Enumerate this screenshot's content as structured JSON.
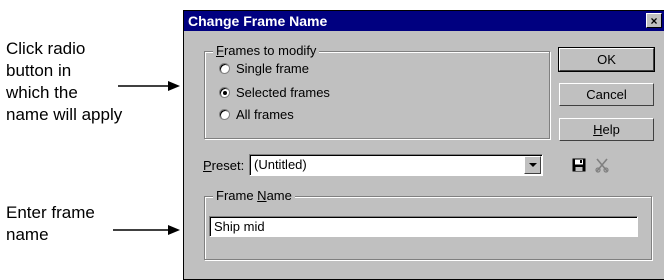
{
  "callouts": {
    "radio_hint": [
      "Click radio",
      "button in",
      "which the",
      "name will apply"
    ],
    "name_hint": [
      "Enter frame",
      "name"
    ]
  },
  "dialog": {
    "title": "Change Frame Name",
    "close_glyph": "×",
    "frames_group": {
      "legend_prefix": "",
      "legend_underlined": "F",
      "legend_rest": "rames to modify",
      "options": [
        {
          "label": "Single frame",
          "checked": false
        },
        {
          "label": "Selected frames",
          "checked": true
        },
        {
          "label": "All frames",
          "checked": false
        }
      ]
    },
    "buttons": {
      "ok": "OK",
      "cancel": "Cancel",
      "help_underlined": "H",
      "help_rest": "elp"
    },
    "preset": {
      "label_underlined": "P",
      "label_rest": "reset:",
      "value": "(Untitled)"
    },
    "name_group": {
      "legend_prefix": "Frame ",
      "legend_underlined": "N",
      "legend_rest": "ame",
      "value": "Ship mid"
    },
    "icons": {
      "save": "save-icon",
      "delete": "delete-icon",
      "dropdown": "chevron-down-icon"
    }
  }
}
